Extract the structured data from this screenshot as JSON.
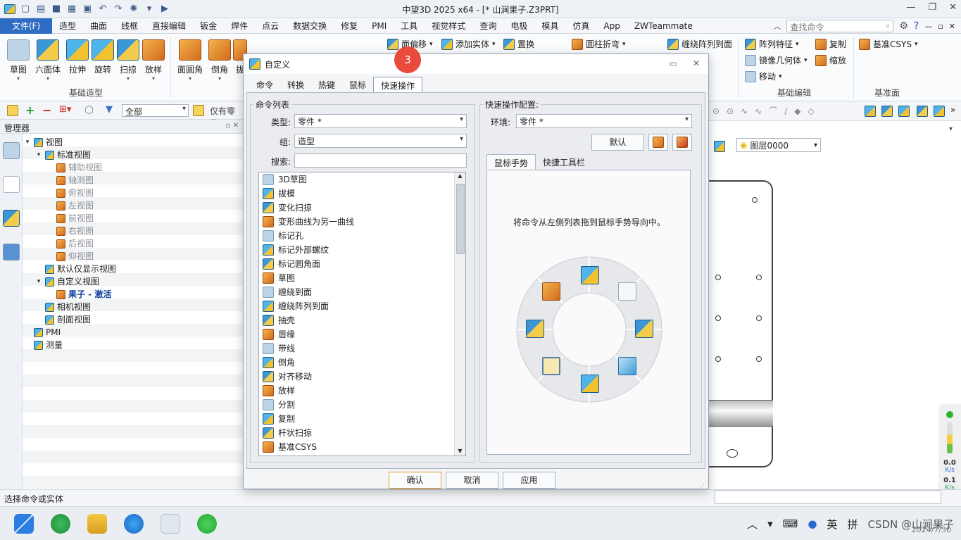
{
  "window": {
    "title": "中望3D 2025 x64 - [* 山涧果子.Z3PRT]"
  },
  "menubar": {
    "file": "文件(F)",
    "tabs": [
      "造型",
      "曲面",
      "线框",
      "直接编辑",
      "钣金",
      "焊件",
      "点云",
      "数据交换",
      "修复",
      "PMI",
      "工具",
      "视觉样式",
      "查询",
      "电极",
      "模具",
      "仿真",
      "App",
      "ZWTeammate"
    ],
    "active_tab": "造型",
    "search_placeholder": "查找命令"
  },
  "ribbon": {
    "big_buttons": [
      "草图",
      "六面体",
      "拉伸",
      "旋转",
      "扫掠",
      "放样",
      "面圆角",
      "倒角",
      "拔"
    ],
    "group_basic_modeling": "基础造型",
    "small_tools": {
      "face_offset": "面偏移",
      "add_solid": "添加实体",
      "replace": "置换",
      "cylinder_fold": "圆柱折弯",
      "wrap_pattern": "缠绕阵列到面",
      "pattern_feature": "阵列特征",
      "mirror_geometry": "镜像几何体",
      "move": "移动",
      "copy": "复制",
      "scale": "缩放",
      "datum_csys": "基准CSYS"
    },
    "group_basic_edit": "基础编辑",
    "group_datum": "基准面"
  },
  "toolbar2": {
    "filter": "全部",
    "only_parts": "仅有零件"
  },
  "manager": {
    "title": "管理器",
    "tree": [
      {
        "label": "视图",
        "level": 0,
        "toggle": "▾",
        "style": "normal"
      },
      {
        "label": "标准视图",
        "level": 1,
        "toggle": "▾",
        "style": "normal"
      },
      {
        "label": "辅助视图",
        "level": 2,
        "toggle": "",
        "style": "dim"
      },
      {
        "label": "轴测图",
        "level": 2,
        "toggle": "",
        "style": "dim"
      },
      {
        "label": "俯视图",
        "level": 2,
        "toggle": "",
        "style": "dim"
      },
      {
        "label": "左视图",
        "level": 2,
        "toggle": "",
        "style": "dim"
      },
      {
        "label": "前视图",
        "level": 2,
        "toggle": "",
        "style": "dim"
      },
      {
        "label": "右视图",
        "level": 2,
        "toggle": "",
        "style": "dim"
      },
      {
        "label": "后视图",
        "level": 2,
        "toggle": "",
        "style": "dim"
      },
      {
        "label": "仰视图",
        "level": 2,
        "toggle": "",
        "style": "dim"
      },
      {
        "label": "默认仅显示视图",
        "level": 1,
        "toggle": "",
        "style": "normal"
      },
      {
        "label": "自定义视图",
        "level": 1,
        "toggle": "▾",
        "style": "normal"
      },
      {
        "label": "果子 - 激活",
        "level": 2,
        "toggle": "",
        "style": "bold"
      },
      {
        "label": "相机视图",
        "level": 1,
        "toggle": "",
        "style": "normal"
      },
      {
        "label": "剖面视图",
        "level": 1,
        "toggle": "",
        "style": "normal"
      },
      {
        "label": "PMI",
        "level": 0,
        "toggle": "",
        "style": "normal"
      },
      {
        "label": "测量",
        "level": 0,
        "toggle": "",
        "style": "normal"
      }
    ]
  },
  "status": {
    "text": "选择命令或实体"
  },
  "viewport": {
    "layer": "图层0000",
    "perf_up": "0.0",
    "perf_up_unit": "K/s",
    "perf_down": "0.1",
    "perf_down_unit": "K/s"
  },
  "dialog": {
    "title": "自定义",
    "tabs": [
      "命令",
      "转换",
      "热键",
      "鼠标",
      "快速操作"
    ],
    "active_tab": "快速操作",
    "badge": "3",
    "cmd_list": {
      "legend": "命令列表",
      "type_label": "类型:",
      "type_value": "零件 *",
      "group_label": "组:",
      "group_value": "造型",
      "search_label": "搜索:",
      "items": [
        "3D草图",
        "拔模",
        "变化扫掠",
        "变形曲线为另一曲线",
        "标记孔",
        "标记外部螺纹",
        "标记圆角面",
        "草图",
        "缠绕到面",
        "缠绕阵列到面",
        "抽壳",
        "唇缘",
        "带线",
        "倒角",
        "对齐移动",
        "放样",
        "分割",
        "复制",
        "杆状扫掠",
        "基准CSYS"
      ]
    },
    "quick_config": {
      "legend": "快速操作配置:",
      "env_label": "环境:",
      "env_value": "零件 *",
      "default_button": "默认",
      "subtabs": [
        "鼠标手势",
        "快捷工具栏"
      ],
      "active_subtab": "鼠标手势",
      "hint": "将命令从左侧列表拖到鼠标手势导向中。"
    },
    "buttons": {
      "ok": "确认",
      "cancel": "取消",
      "apply": "应用"
    }
  },
  "taskbar": {
    "ime_lang": "英",
    "ime_mode": "拼",
    "watermark": "CSDN @山涧果子",
    "date": "2024/7/30"
  }
}
